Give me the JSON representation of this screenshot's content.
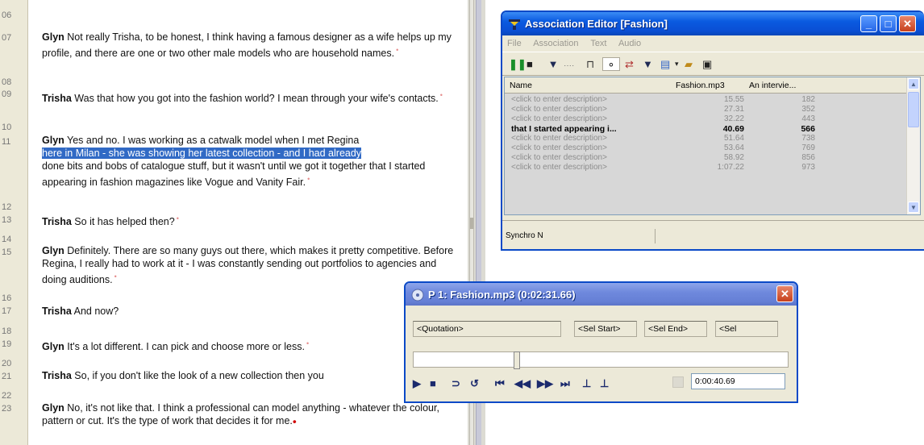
{
  "transcript": {
    "line_numbers": [
      "06",
      "07",
      "08",
      "09",
      "10",
      "11",
      "12",
      "13",
      "14",
      "15",
      "16",
      "17",
      "18",
      "19",
      "20",
      "21",
      "22",
      "23"
    ],
    "paragraphs": [
      {
        "speaker": "Glyn",
        "text": " Not really Trisha, to be honest, I think having a famous designer as a wife helps up my profile, and there are one or two other male models who are household names."
      },
      {
        "speaker": "Trisha",
        "text": " Was that how you got into the fashion world? I mean through your wife's contacts."
      },
      {
        "speaker": "Glyn",
        "text_before": " Yes and no. I was working as a catwalk model when I met Regina",
        "text_highlight": "here in Milan - she was showing her latest collection - and I had already",
        "text_after": "done bits and bobs of catalogue stuff, but it wasn't until we got it together that I started appearing in fashion magazines like Vogue and Vanity Fair."
      },
      {
        "speaker": "Trisha",
        "text": " So it has helped then?"
      },
      {
        "speaker": "Glyn",
        "text": " Definitely. There are so many guys out there, which makes it pretty competitive. Before Regina, I really had to work at it - I was constantly sending out portfolios to agencies and doing auditions."
      },
      {
        "speaker": "Trisha",
        "text": " And now?"
      },
      {
        "speaker": "Glyn",
        "text": " It's a lot different. I can pick and choose more or less."
      },
      {
        "speaker": "Trisha",
        "text": " So, if you don't like the look of a new collection then you"
      },
      {
        "speaker": "Glyn",
        "text": " No, it's not like that. I think a professional can model anything - whatever the colour, pattern or cut. It's the type of work that decides it for me."
      }
    ]
  },
  "assoc_window": {
    "title": "Association Editor [Fashion]",
    "menu": [
      "File",
      "Association",
      "Text",
      "Audio"
    ],
    "columns": [
      "Name",
      "Fashion.mp3",
      "An intervie..."
    ],
    "rows": [
      {
        "name": "<click to enter description>",
        "time": "15.55",
        "pos": "182",
        "bold": false
      },
      {
        "name": "<click to enter description>",
        "time": "27.31",
        "pos": "352",
        "bold": false
      },
      {
        "name": "<click to enter description>",
        "time": "32.22",
        "pos": "443",
        "bold": false
      },
      {
        "name": "that I started appearing i...",
        "time": "40.69",
        "pos": "566",
        "bold": true
      },
      {
        "name": "<click to enter description>",
        "time": "51.64",
        "pos": "738",
        "bold": false
      },
      {
        "name": "<click to enter description>",
        "time": "53.64",
        "pos": "769",
        "bold": false
      },
      {
        "name": "<click to enter description>",
        "time": "58.92",
        "pos": "856",
        "bold": false
      },
      {
        "name": "<click to enter description>",
        "time": "1:07.22",
        "pos": "973",
        "bold": false
      }
    ],
    "status": "Synchro N"
  },
  "player_window": {
    "title": "P 1: Fashion.mp3 (0:02:31.66)",
    "quotation": "<Quotation>",
    "sel_start": "<Sel Start>",
    "sel_end": "<Sel End>",
    "sel": "<Sel",
    "time": "0:00:40.69"
  },
  "colors": {
    "titlebar": "#0a5ae0",
    "selection": "#316ac5",
    "window_bg": "#ece9d8"
  }
}
